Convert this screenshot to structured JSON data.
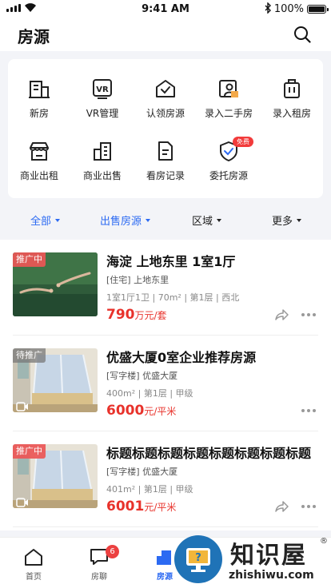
{
  "status_bar": {
    "time": "9:41 AM",
    "battery": "100%"
  },
  "header": {
    "title": "房源"
  },
  "quick_actions": [
    {
      "label": "新房",
      "icon": "building-icon"
    },
    {
      "label": "VR管理",
      "icon": "vr-icon"
    },
    {
      "label": "认领房源",
      "icon": "house-check-icon"
    },
    {
      "label": "录入二手房",
      "icon": "person-card-icon"
    },
    {
      "label": "录入租房",
      "icon": "rent-box-icon"
    },
    {
      "label": "商业出租",
      "icon": "store-icon"
    },
    {
      "label": "商业出售",
      "icon": "office-building-icon"
    },
    {
      "label": "看房记录",
      "icon": "document-icon"
    },
    {
      "label": "委托房源",
      "icon": "shield-check-icon",
      "badge": "免费"
    }
  ],
  "filters": {
    "all": "全部",
    "sale": "出售房源",
    "region": "区域",
    "more": "更多"
  },
  "listings": [
    {
      "tag": "推广中",
      "title": "海淀 上地东里 1室1厅",
      "type": "[住宅] 上地东里",
      "info": "1室1厅1卫 | 70m² | 第1层 | 西北",
      "price": "790",
      "unit": "万元/套"
    },
    {
      "tag": "待推广",
      "title": "优盛大厦0室企业推荐房源",
      "type": "[写字楼] 优盛大厦",
      "info": "400m² | 第1层 | 甲级",
      "price": "6000",
      "unit": "元/平米"
    },
    {
      "tag": "推广中",
      "title": "标题标题标题标题标题标题标题标题",
      "type": "[写字楼] 优盛大厦",
      "info": "401m² | 第1层 | 甲级",
      "price": "6001",
      "unit": "元/平米"
    }
  ],
  "tabbar": {
    "home": "首页",
    "chat": "房聊",
    "chat_badge": "6",
    "listings": "房源"
  },
  "watermark": {
    "name": "知识屋",
    "url": "zhishiwu.com"
  },
  "colors": {
    "accent": "#2c6af2",
    "price": "#e8322b",
    "tag": "#ec5656"
  }
}
